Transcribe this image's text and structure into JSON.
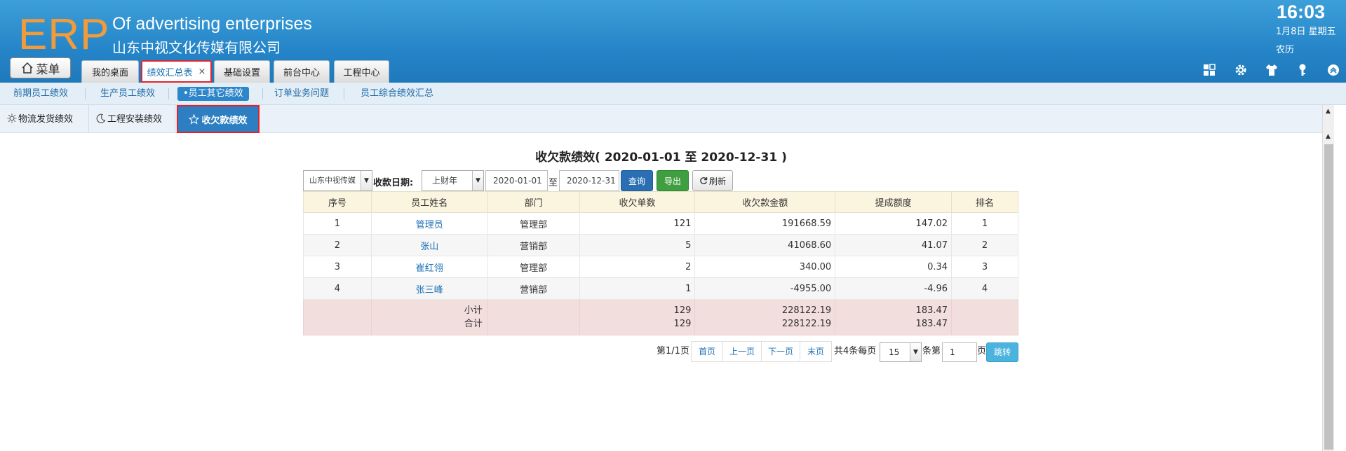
{
  "header": {
    "logo": "ERP",
    "company_en": "Of advertising enterprises",
    "company_cn": "山东中视文化传媒有限公司",
    "time": "16:03",
    "date": "1月8日 星期五",
    "lunar": "农历",
    "menu_label": "菜单",
    "tabs": [
      {
        "label": "我的桌面"
      },
      {
        "label": "绩效汇总表",
        "close": "×"
      },
      {
        "label": "基础设置"
      },
      {
        "label": "前台中心"
      },
      {
        "label": "工程中心"
      }
    ],
    "icons": [
      "apps-icon",
      "gear-icon",
      "shirt-icon",
      "key-icon",
      "collapse-up-icon"
    ]
  },
  "subnav1": [
    "前期员工绩效",
    "生产员工绩效",
    "•员工其它绩效",
    "订单业务问题",
    "员工综合绩效汇总"
  ],
  "subnav2": {
    "items": [
      "物流发货绩效",
      "工程安装绩效"
    ],
    "active": "收欠款绩效"
  },
  "report": {
    "title": "收欠款绩效( 2020-01-01 至 2020-12-31 )",
    "company_select": "山东中视传媒",
    "date_label": "收款日期:",
    "period_select": "上财年",
    "start_date": "2020-01-01",
    "to": "至",
    "end_date": "2020-12-31",
    "query": "查询",
    "export": "导出",
    "refresh": "刷新"
  },
  "table": {
    "columns": [
      "序号",
      "员工姓名",
      "部门",
      "收欠单数",
      "收欠款金额",
      "提成额度",
      "排名"
    ],
    "rows": [
      {
        "no": "1",
        "name": "管理员",
        "dept": "管理部",
        "count": "121",
        "amount": "191668.59",
        "commission": "147.02",
        "rank": "1"
      },
      {
        "no": "2",
        "name": "张山",
        "dept": "营销部",
        "count": "5",
        "amount": "41068.60",
        "commission": "41.07",
        "rank": "2"
      },
      {
        "no": "3",
        "name": "崔红翎",
        "dept": "管理部",
        "count": "2",
        "amount": "340.00",
        "commission": "0.34",
        "rank": "3"
      },
      {
        "no": "4",
        "name": "张三峰",
        "dept": "营销部",
        "count": "1",
        "amount": "-4955.00",
        "commission": "-4.96",
        "rank": "4"
      }
    ],
    "subtotal": {
      "label": "小计",
      "count": "129",
      "amount": "228122.19",
      "commission": "183.47"
    },
    "total": {
      "label": "合计",
      "count": "129",
      "amount": "228122.19",
      "commission": "183.47"
    }
  },
  "pager": {
    "page_info": "第1/1页",
    "first": "首页",
    "prev": "上一页",
    "next": "下一页",
    "last": "末页",
    "summary": "共4条每页",
    "page_size": "15",
    "per_unit": "条第",
    "jump_value": "1",
    "page_unit": "页",
    "jump": "跳转"
  }
}
